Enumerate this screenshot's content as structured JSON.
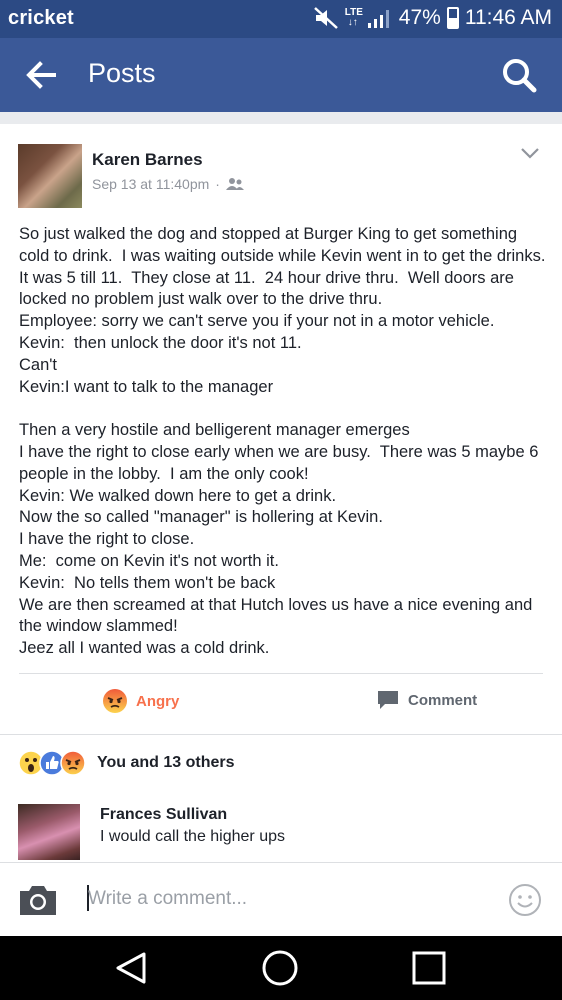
{
  "status_bar": {
    "carrier": "cricket",
    "network": "LTE",
    "battery": "47%",
    "time": "11:46 AM",
    "icons": [
      "mute-icon",
      "lte-icon",
      "signal-icon",
      "battery-icon"
    ]
  },
  "app_bar": {
    "title": "Posts",
    "back_icon": "arrow-left-icon",
    "search_icon": "search-icon",
    "color": "#3b5998"
  },
  "post": {
    "author": "Karen Barnes",
    "timestamp": "Sep 13 at 11:40pm",
    "separator": "·",
    "audience_icon": "friends-icon",
    "options_icon": "chevron-down-icon",
    "text": "So just walked the dog and stopped at Burger King to get something cold to drink.  I was waiting outside while Kevin went in to get the drinks.  It was 5 till 11.  They close at 11.  24 hour drive thru.  Well doors are locked no problem just walk over to the drive thru.\nEmployee: sorry we can't serve you if your not in a motor vehicle.\nKevin:  then unlock the door it's not 11.\nCan't\nKevin:I want to talk to the manager\n\nThen a very hostile and belligerent manager emerges\nI have the right to close early when we are busy.  There was 5 maybe 6 people in the lobby.  I am the only cook!\nKevin: We walked down here to get a drink.\nNow the so called \"manager\" is hollering at Kevin.\nI have the right to close.\nMe:  come on Kevin it's not worth it.\nKevin:  No tells them won't be back\nWe are then screamed at that Hutch loves us have a nice evening and the window slammed!\nJeez all I wanted was a cold drink."
  },
  "actions": {
    "reaction_label": "Angry",
    "reaction_color": "#f7714c",
    "comment_label": "Comment"
  },
  "reactions_summary": {
    "icons": [
      "wow-icon",
      "like-icon",
      "angry-icon"
    ],
    "text": "You and 13 others"
  },
  "comments": [
    {
      "author": "Frances Sullivan",
      "text": "I would call the higher ups"
    }
  ],
  "composer": {
    "placeholder": "Write a comment...",
    "camera_icon": "camera-icon",
    "emoji_icon": "emoji-icon"
  },
  "nav_bar": {
    "icons": [
      "nav-back-icon",
      "nav-home-icon",
      "nav-recent-apps-icon"
    ]
  }
}
